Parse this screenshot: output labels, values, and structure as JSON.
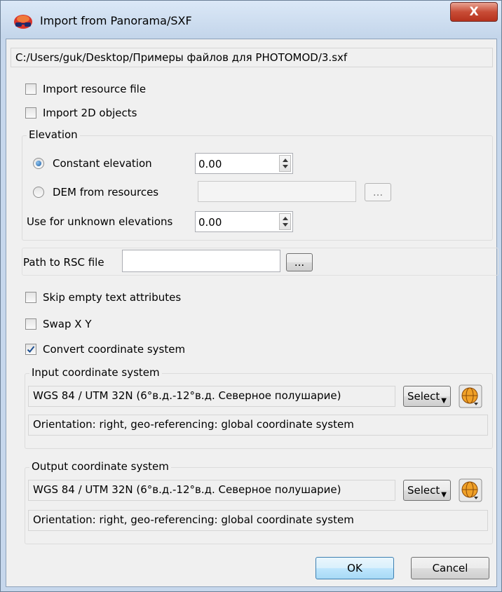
{
  "window": {
    "title": "Import from Panorama/SXF",
    "close_label": "X"
  },
  "file_path": "C:/Users/guk/Desktop/Примеры файлов для PHOTOMOD/3.sxf",
  "options": {
    "import_resource_file": {
      "label": "Import resource file",
      "checked": false
    },
    "import_2d_objects": {
      "label": "Import 2D objects",
      "checked": false
    }
  },
  "elevation": {
    "group_label": "Elevation",
    "constant_label": "Constant elevation",
    "constant_value": "0.00",
    "dem_label": "DEM from resources",
    "dem_value": "",
    "browse_label": "...",
    "unknown_label": "Use for unknown elevations",
    "unknown_value": "0.00"
  },
  "rsc": {
    "label": "Path to RSC file",
    "value": "",
    "browse_label": "..."
  },
  "checks": {
    "skip_empty": {
      "label": "Skip empty text attributes",
      "checked": false
    },
    "swap_xy": {
      "label": "Swap X Y",
      "checked": false
    },
    "convert_cs": {
      "label": "Convert coordinate system",
      "checked": true
    }
  },
  "input_cs": {
    "group_label": "Input coordinate system",
    "value": "WGS 84 / UTM 32N (6°в.д.-12°в.д. Северное полушарие)",
    "select_label": "Select",
    "info": "Orientation: right, geo-referencing: global coordinate system"
  },
  "output_cs": {
    "group_label": "Output coordinate system",
    "value": "WGS 84 / UTM 32N (6°в.д.-12°в.д. Северное полушарие)",
    "select_label": "Select",
    "info": "Orientation: right, geo-referencing: global coordinate system"
  },
  "buttons": {
    "ok": "OK",
    "cancel": "Cancel"
  },
  "colors": {
    "accent": "#3c7fb1",
    "close": "#c84c36",
    "check": "#1d4f91"
  }
}
